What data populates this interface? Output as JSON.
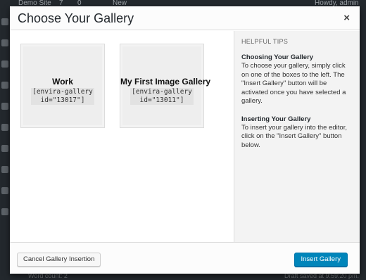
{
  "adminbar": {
    "site_name": "Demo Site",
    "updates_count": "7",
    "comments_count": "0",
    "new_label": "New",
    "greeting": "Howdy, admin"
  },
  "editor": {
    "word_count": "Word count: 2",
    "draft_saved": "Draft saved at 9:59:20 pm."
  },
  "modal": {
    "title": "Choose Your Gallery",
    "close_symbol": "×",
    "galleries": [
      {
        "title": "Work",
        "shortcode": "[envira-gallery\nid=\"13017\"]"
      },
      {
        "title": "My First Image Gallery",
        "shortcode": "[envira-gallery\nid=\"13011\"]"
      }
    ],
    "sidebar": {
      "heading": "HELPFUL TIPS",
      "tips": [
        {
          "title": "Choosing Your Gallery",
          "text": "To choose your gallery, simply click on one of the boxes to the left. The \"Insert Gallery\" button will be activated once you have selected a gallery."
        },
        {
          "title": "Inserting Your Gallery",
          "text": "To insert your gallery into the editor, click on the \"Insert Gallery\" button below."
        }
      ]
    },
    "footer": {
      "cancel_label": "Cancel Gallery Insertion",
      "insert_label": "Insert Gallery"
    }
  },
  "colors": {
    "primary_button": "#0085ba",
    "admin_dark": "#23282d"
  }
}
